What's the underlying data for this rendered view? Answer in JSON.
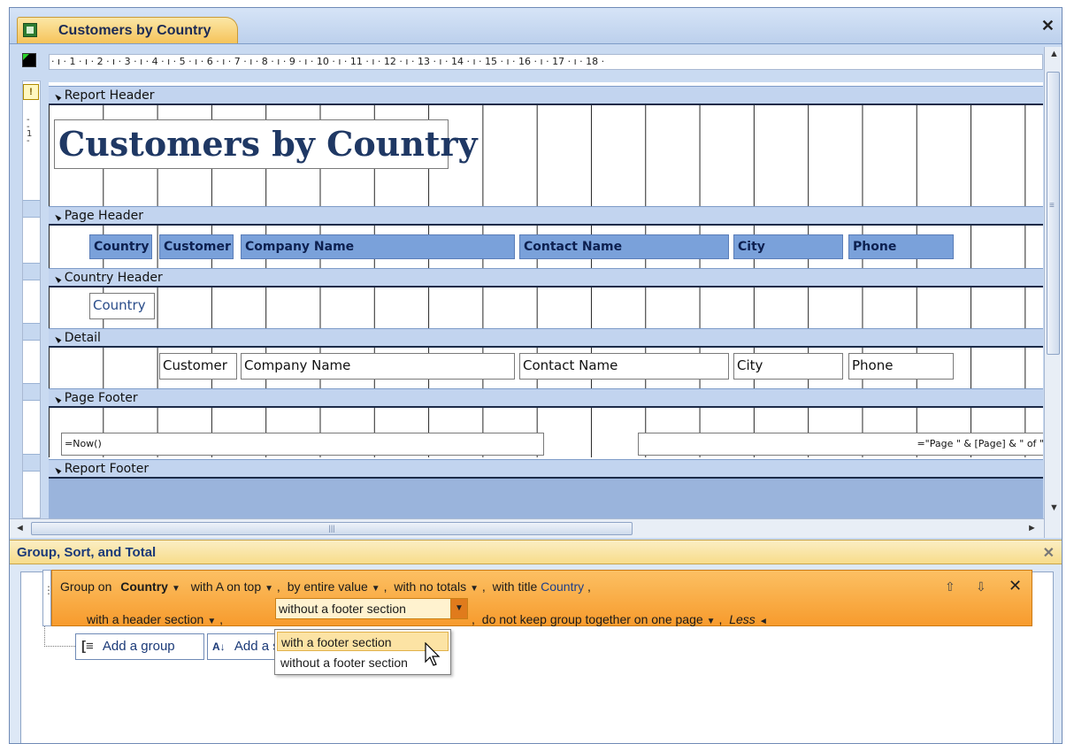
{
  "window": {
    "tab_title": "Customers by Country",
    "close_glyph": "✕"
  },
  "ruler": {
    "text": "· ı · 1 · ı · 2 · ı · 3 · ı · 4 · ı · 5 · ı · 6 · ı · 7 · ı · 8 · ı · 9 · ı · 10 · ı · 11 · ı · 12 · ı · 13 · ı · 14 · ı · 15 · ı · 16 · ı · 17 · ı · 18 ·"
  },
  "sections": {
    "report_header": "Report Header",
    "page_header": "Page Header",
    "country_header": "Country Header",
    "detail": "Detail",
    "page_footer": "Page Footer",
    "report_footer": "Report Footer"
  },
  "report_title": "Customers by Country",
  "page_header_labels": {
    "country": "Country",
    "customer": "Customer",
    "company_name": "Company Name",
    "contact_name": "Contact Name",
    "city": "City",
    "phone": "Phone"
  },
  "country_field": "Country",
  "detail_fields": {
    "customer": "Customer",
    "company_name": "Company Name",
    "contact_name": "Contact Name",
    "city": "City",
    "phone": "Phone"
  },
  "page_footer_fields": {
    "now": "=Now()",
    "page": "=\"Page \" & [Page] & \" of \""
  },
  "group_pane": {
    "title": "Group, Sort, and Total",
    "line1": {
      "group_on": "Group on",
      "field": "Country",
      "sort": "with A on top",
      "by": "by entire value",
      "totals": "with no totals",
      "title_prefix": "with title",
      "title_link": "Country"
    },
    "line2": {
      "header": "with a header section",
      "footer_selected": "without a footer section",
      "keep": "do not keep group together on one page",
      "less": "Less"
    },
    "add_group": "Add a group",
    "add_sort": "Add a sort",
    "dropdown_options": [
      "with a footer section",
      "without a footer section"
    ]
  }
}
